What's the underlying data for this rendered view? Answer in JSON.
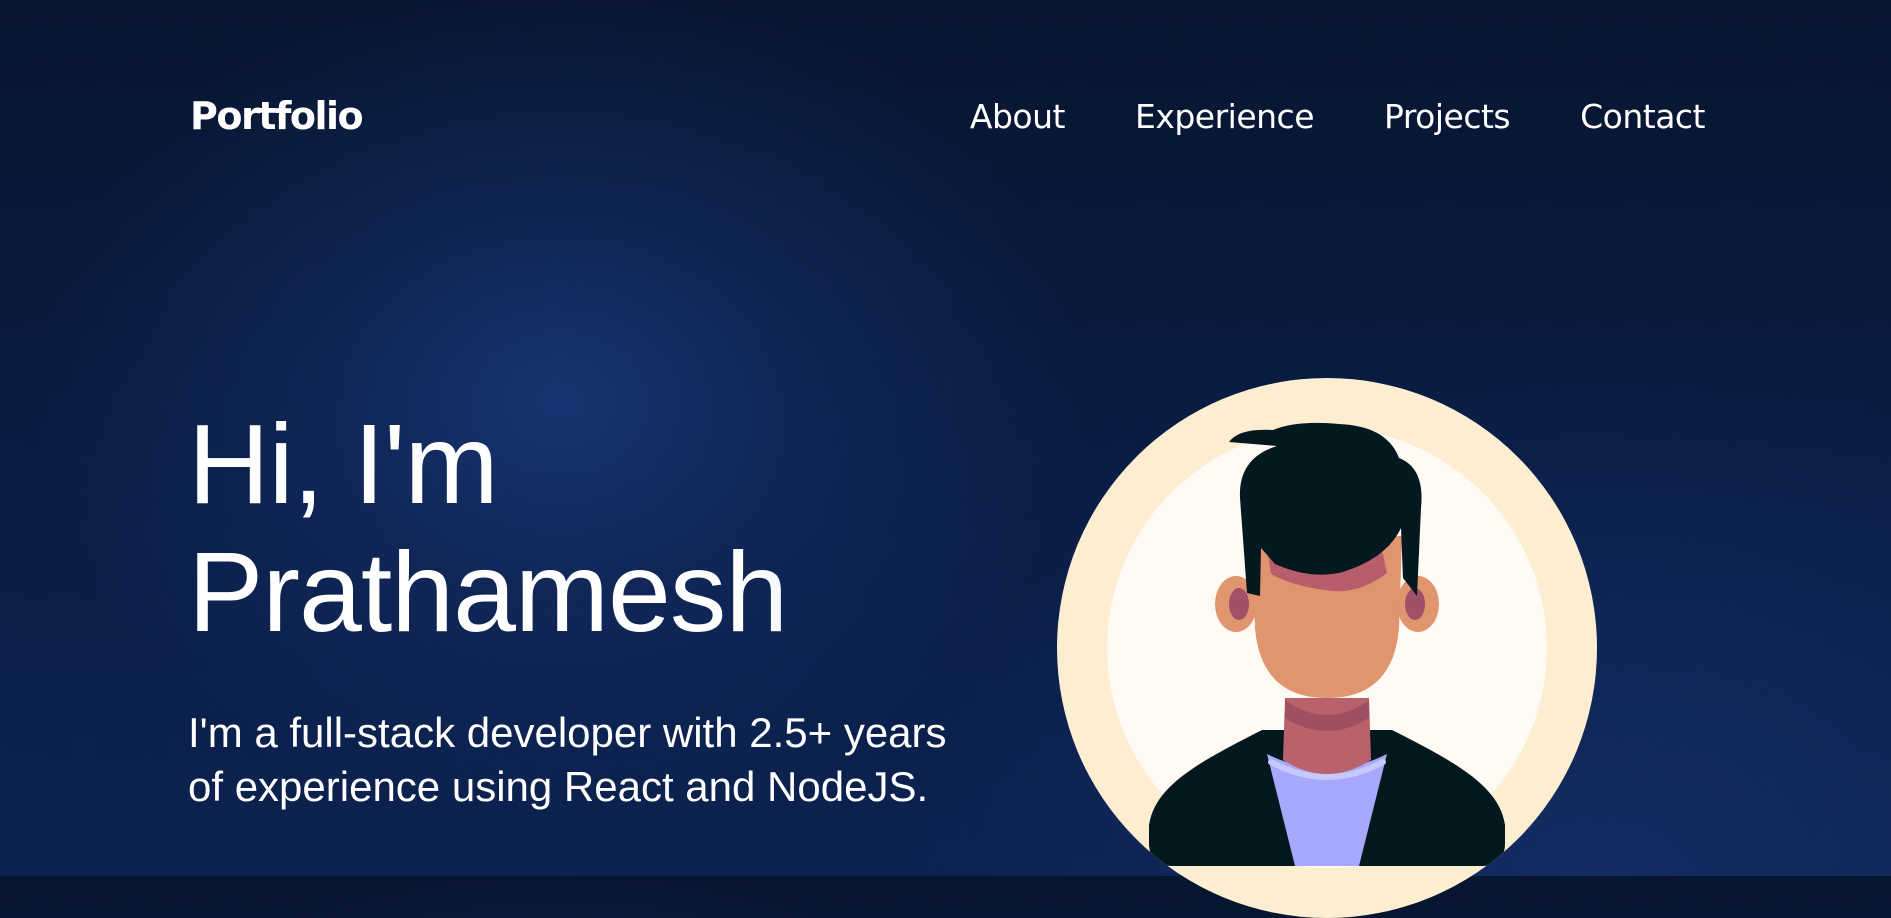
{
  "nav": {
    "logo": "Portfolio",
    "links": [
      "About",
      "Experience",
      "Projects",
      "Contact"
    ]
  },
  "hero": {
    "greeting": "Hi, I'm",
    "name": "Prathamesh",
    "description": "I'm a full-stack developer with 2.5+ years of experience using React and NodeJS.",
    "image_icon": "developer-avatar-illustration"
  },
  "colors": {
    "background": "#061634",
    "text": "#ffffff",
    "avatar_outer_ring": "#fdedd1",
    "avatar_inner_circle": "#fffaf3",
    "avatar_skin": "#e0956e",
    "avatar_hair": "#04181f",
    "avatar_shirt": "#a6a8fb",
    "avatar_jacket": "#03181d"
  }
}
